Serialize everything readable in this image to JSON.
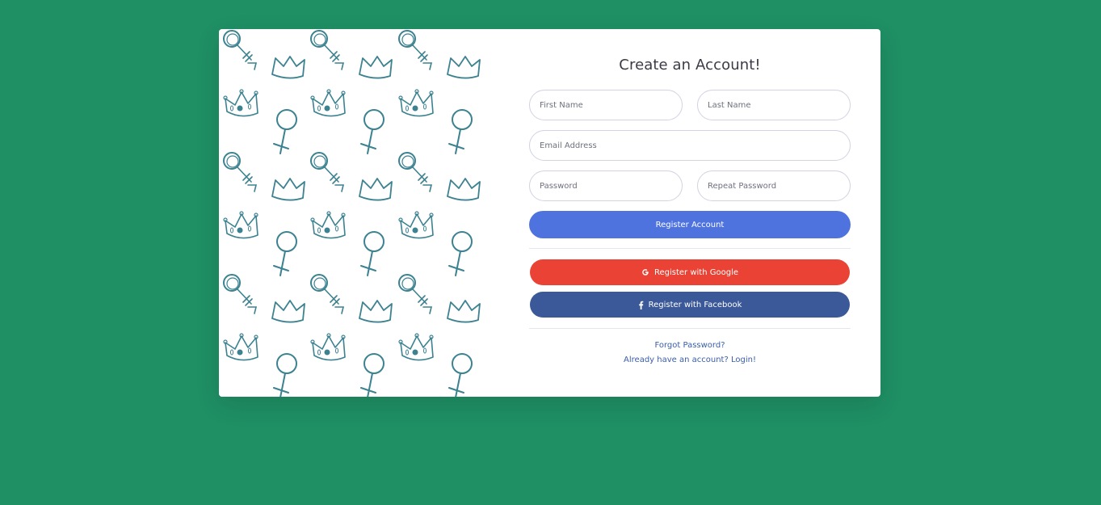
{
  "page": {
    "background_color": "#1f8f64"
  },
  "card": {
    "title": "Create an Account!",
    "image_panel": {
      "pattern_motifs": [
        "female-symbol",
        "crown"
      ],
      "pattern_color": "#3c8290"
    }
  },
  "form": {
    "first_name": {
      "placeholder": "First Name",
      "value": ""
    },
    "last_name": {
      "placeholder": "Last Name",
      "value": ""
    },
    "email": {
      "placeholder": "Email Address",
      "value": ""
    },
    "password": {
      "placeholder": "Password",
      "value": ""
    },
    "repeat_password": {
      "placeholder": "Repeat Password",
      "value": ""
    }
  },
  "buttons": {
    "register": {
      "label": "Register Account",
      "color": "#4e73df"
    },
    "google": {
      "label": "Register with Google",
      "icon": "google-icon",
      "color": "#ea4335"
    },
    "facebook": {
      "label": "Register with Facebook",
      "icon": "facebook-icon",
      "color": "#3b5998"
    }
  },
  "links": {
    "forgot_password": "Forgot Password?",
    "login": "Already have an account? Login!"
  }
}
